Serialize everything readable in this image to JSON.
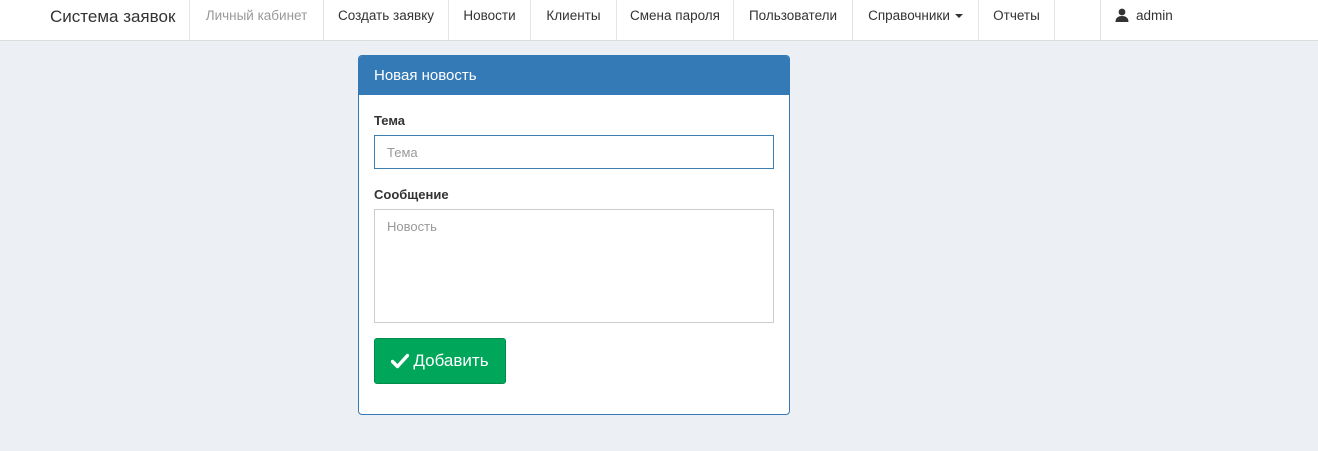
{
  "navbar": {
    "brand": "Система заявок",
    "items": [
      {
        "label": "Личный кабинет"
      },
      {
        "label": "Создать заявку"
      },
      {
        "label": "Новости"
      },
      {
        "label": "Клиенты"
      },
      {
        "label": "Смена пароля"
      },
      {
        "label": "Пользователи"
      },
      {
        "label": "Справочники"
      },
      {
        "label": "Отчеты"
      }
    ],
    "user": {
      "name": "admin",
      "icon": "user-icon"
    }
  },
  "panel": {
    "title": "Новая новость",
    "subject": {
      "label": "Тема",
      "placeholder": "Тема",
      "value": ""
    },
    "message": {
      "label": "Сообщение",
      "placeholder": "Новость",
      "value": ""
    },
    "submit": {
      "label": "Добавить",
      "icon": "check-icon",
      "color": "#00a65a"
    }
  },
  "colors": {
    "primary": "#337ab7",
    "success": "#00a65a",
    "background": "#eceff4"
  }
}
